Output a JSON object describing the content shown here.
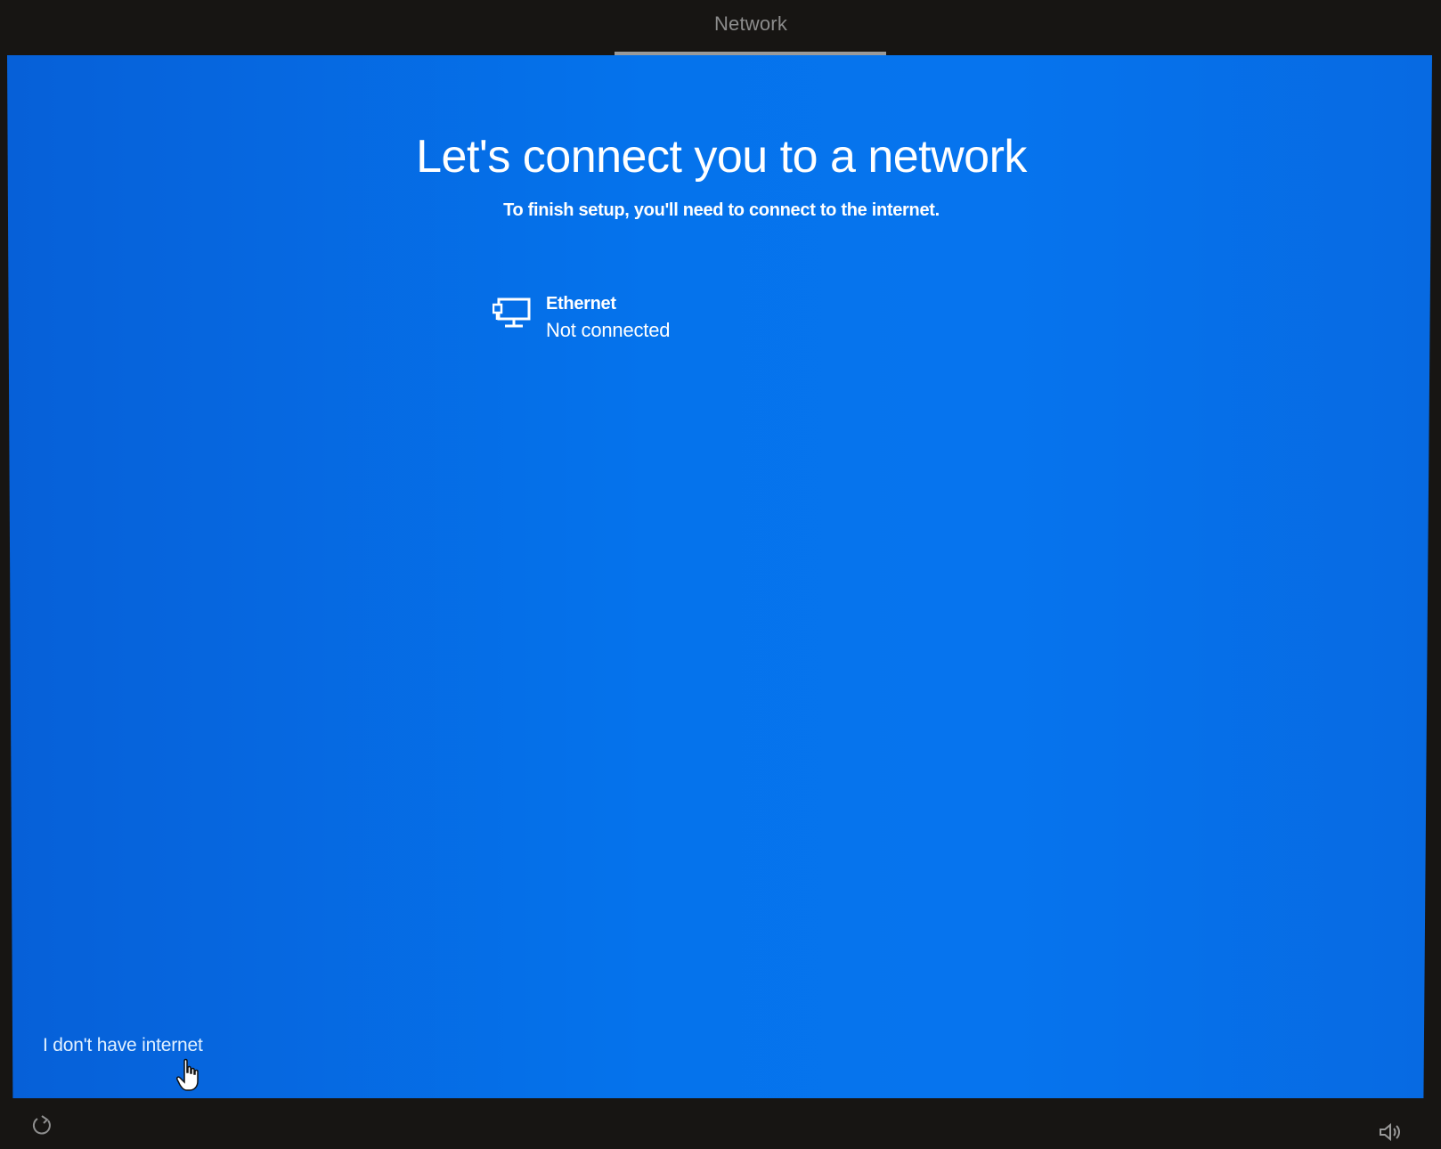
{
  "header": {
    "title": "Network"
  },
  "main": {
    "heading": "Let's connect you to a network",
    "subheading": "To finish setup, you'll need to connect to the internet.",
    "networks": [
      {
        "icon": "ethernet-icon",
        "name": "Ethernet",
        "status": "Not connected"
      }
    ],
    "no_internet_link": "I don't have internet"
  },
  "footer": {
    "left_icon": "ease-of-access-icon",
    "right_icon": "volume-icon"
  },
  "colors": {
    "screen_background": "#0671EB",
    "bezel": "#171513",
    "text": "#FFFFFF",
    "link_text": "#E2F1FF"
  }
}
